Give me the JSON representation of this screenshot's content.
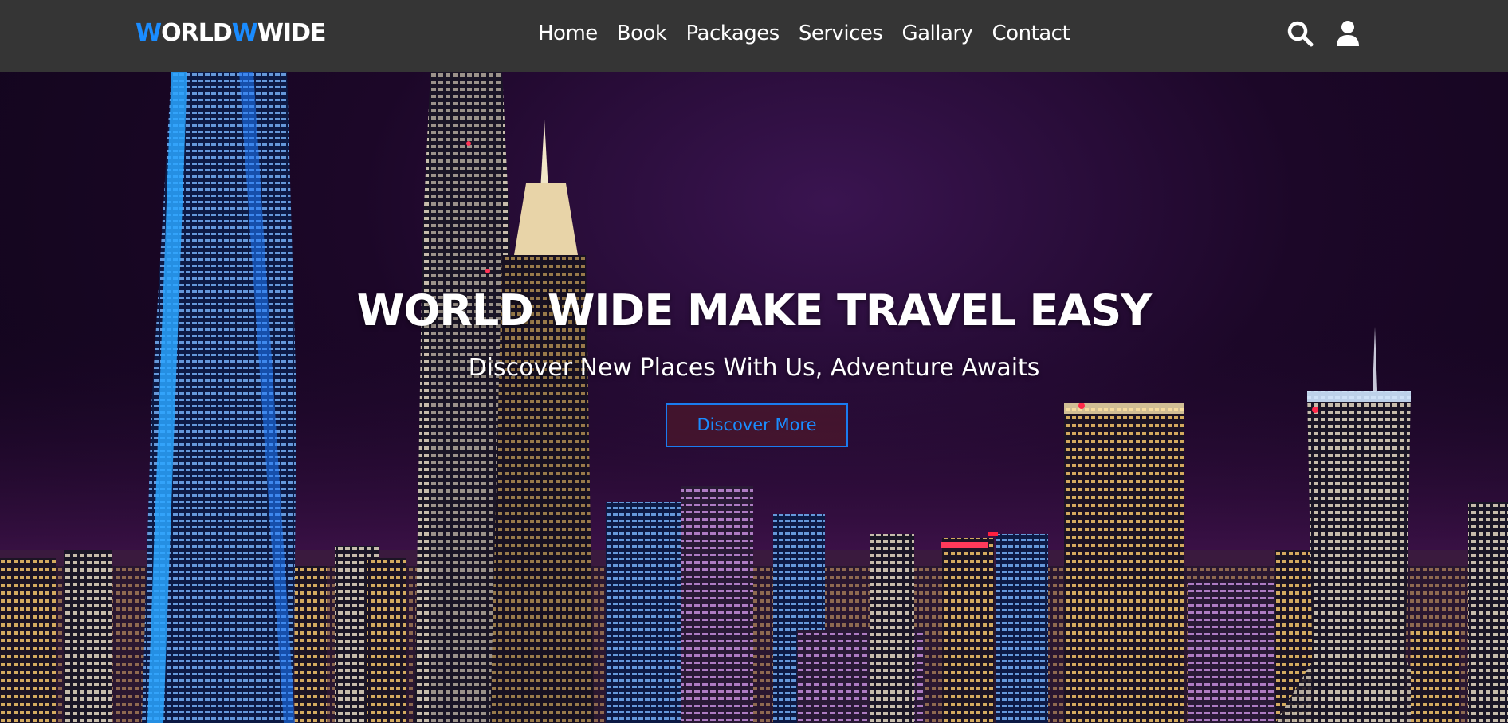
{
  "navbar": {
    "logo": {
      "part1_accent": "W",
      "part2": "ORLD",
      "part3_accent": "W",
      "part4": "WIDE"
    },
    "links": [
      "Home",
      "Book",
      "Packages",
      "Services",
      "Gallary",
      "Contact"
    ],
    "icons": [
      "search-icon",
      "user-icon"
    ]
  },
  "hero": {
    "title": "WORLD WIDE MAKE TRAVEL EASY",
    "subtitle": "Discover New Places With Us, Adventure Awaits",
    "button_label": "Discover More",
    "background": "night-city-skyline"
  },
  "colors": {
    "navbar_bg": "#353535",
    "accent": "#1a8cff",
    "text": "#ffffff"
  }
}
